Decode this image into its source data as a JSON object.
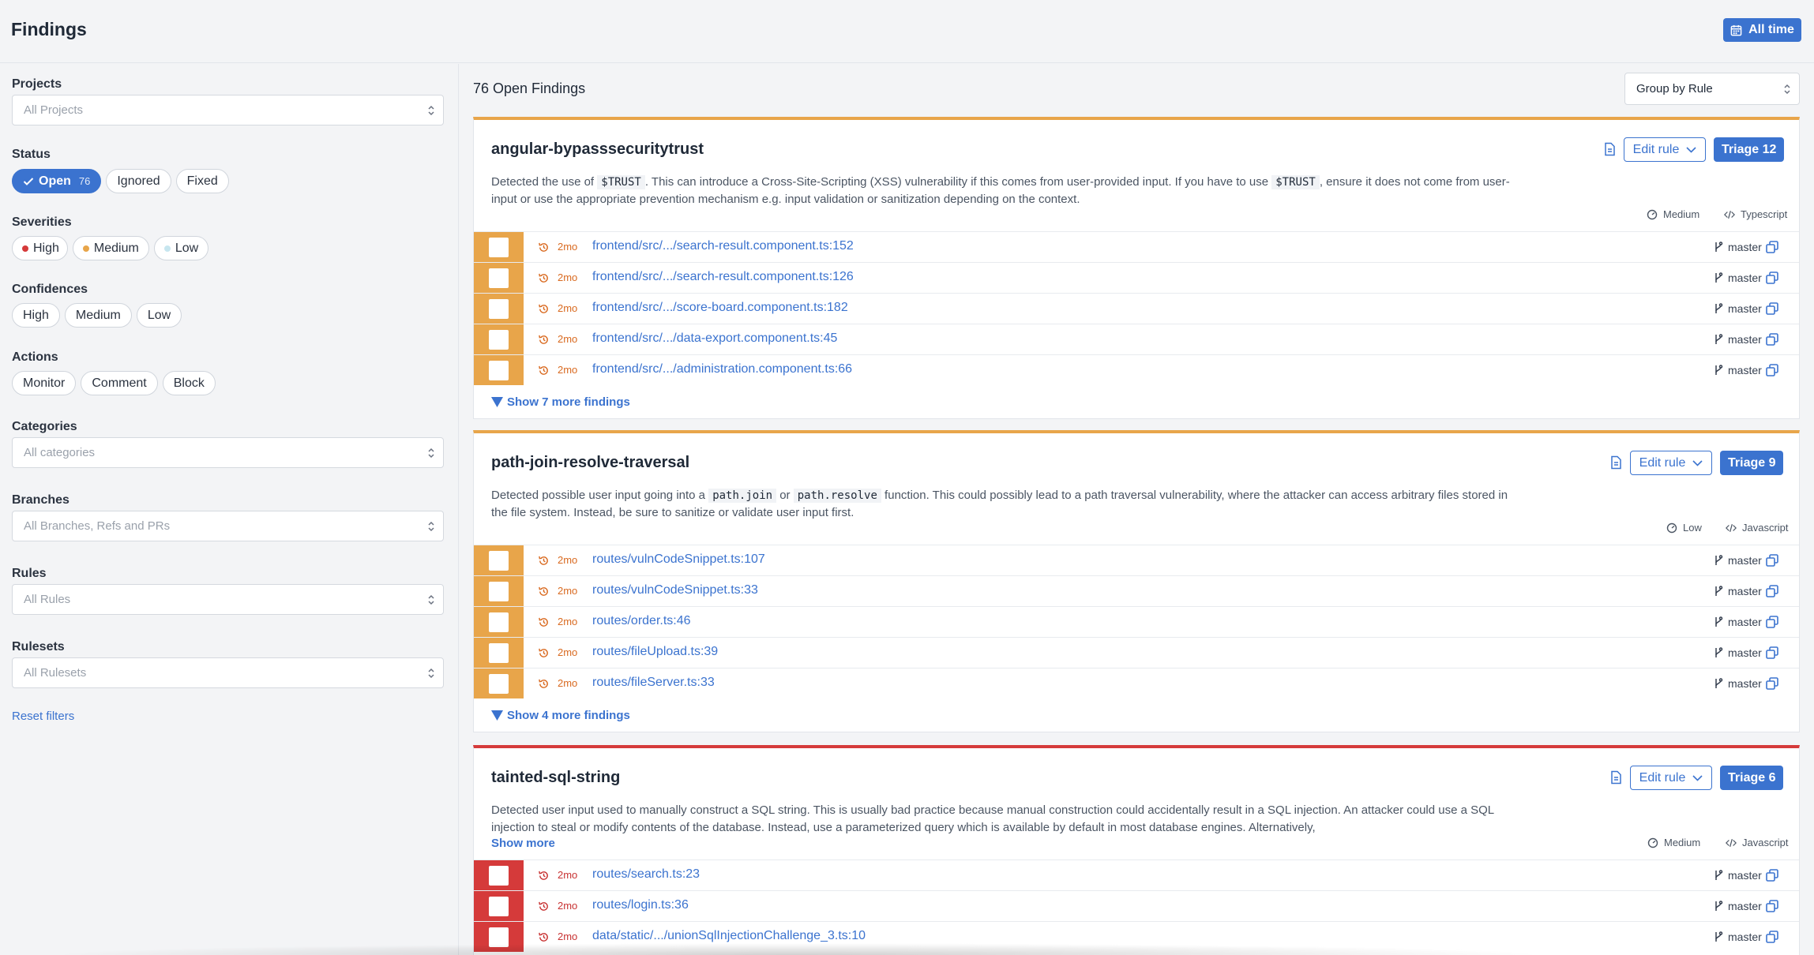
{
  "header": {
    "title": "Findings",
    "date_filter": "All time"
  },
  "sidebar": {
    "projects": {
      "label": "Projects",
      "placeholder": "All Projects"
    },
    "status": {
      "label": "Status",
      "options": [
        {
          "label": "Open",
          "count": "76",
          "active": true
        },
        {
          "label": "Ignored"
        },
        {
          "label": "Fixed"
        }
      ]
    },
    "severities": {
      "label": "Severities",
      "options": [
        {
          "label": "High",
          "color": "#d53a3a"
        },
        {
          "label": "Medium",
          "color": "#e8a54a"
        },
        {
          "label": "Low",
          "color": "#c7e6ef"
        }
      ]
    },
    "confidences": {
      "label": "Confidences",
      "options": [
        "High",
        "Medium",
        "Low"
      ]
    },
    "actions": {
      "label": "Actions",
      "options": [
        "Monitor",
        "Comment",
        "Block"
      ]
    },
    "categories": {
      "label": "Categories",
      "placeholder": "All categories"
    },
    "branches": {
      "label": "Branches",
      "placeholder": "All Branches, Refs and PRs"
    },
    "rules": {
      "label": "Rules",
      "placeholder": "All Rules"
    },
    "rulesets": {
      "label": "Rulesets",
      "placeholder": "All Rulesets"
    },
    "reset": "Reset filters"
  },
  "main": {
    "count_title": "76 Open Findings",
    "group_by": "Group by Rule",
    "edit_rule_label": "Edit rule",
    "groups": [
      {
        "rule": "angular-bypasssecuritytrust",
        "severity": "medium",
        "desc_parts": [
          "Detected the use of ",
          "$TRUST",
          ". This can introduce a Cross-Site-Scripting (XSS) vulnerability if this comes from user-provided input. If you have to use ",
          "$TRUST",
          ", ensure it does not come from user-input or use the appropriate prevention mechanism e.g. input validation or sanitization depending on the context."
        ],
        "triage": "Triage 12",
        "confidence": "Medium",
        "language": "Typescript",
        "findings": [
          {
            "age": "2mo",
            "path": "frontend/src/.../search-result.component.ts:152",
            "branch": "master"
          },
          {
            "age": "2mo",
            "path": "frontend/src/.../search-result.component.ts:126",
            "branch": "master"
          },
          {
            "age": "2mo",
            "path": "frontend/src/.../score-board.component.ts:182",
            "branch": "master"
          },
          {
            "age": "2mo",
            "path": "frontend/src/.../data-export.component.ts:45",
            "branch": "master"
          },
          {
            "age": "2mo",
            "path": "frontend/src/.../administration.component.ts:66",
            "branch": "master"
          }
        ],
        "show_more_findings": "Show 7 more findings"
      },
      {
        "rule": "path-join-resolve-traversal",
        "severity": "medium",
        "desc_parts": [
          "Detected possible user input going into a ",
          "path.join",
          " or ",
          "path.resolve",
          " function. This could possibly lead to a path traversal vulnerability, where the attacker can access arbitrary files stored in the file system. Instead, be sure to sanitize or validate user input first."
        ],
        "triage": "Triage 9",
        "confidence": "Low",
        "language": "Javascript",
        "findings": [
          {
            "age": "2mo",
            "path": "routes/vulnCodeSnippet.ts:107",
            "branch": "master"
          },
          {
            "age": "2mo",
            "path": "routes/vulnCodeSnippet.ts:33",
            "branch": "master"
          },
          {
            "age": "2mo",
            "path": "routes/order.ts:46",
            "branch": "master"
          },
          {
            "age": "2mo",
            "path": "routes/fileUpload.ts:39",
            "branch": "master"
          },
          {
            "age": "2mo",
            "path": "routes/fileServer.ts:33",
            "branch": "master"
          }
        ],
        "show_more_findings": "Show 4 more findings"
      },
      {
        "rule": "tainted-sql-string",
        "severity": "high",
        "description": "Detected user input used to manually construct a SQL string. This is usually bad practice because manual construction could accidentally result in a SQL injection. An attacker could use a SQL injection to steal or modify contents of the database. Instead, use a parameterized query which is available by default in most database engines. Alternatively,",
        "show_more": "Show more",
        "triage": "Triage 6",
        "confidence": "Medium",
        "language": "Javascript",
        "findings": [
          {
            "age": "2mo",
            "path": "routes/search.ts:23",
            "branch": "master"
          },
          {
            "age": "2mo",
            "path": "routes/login.ts:36",
            "branch": "master"
          },
          {
            "age": "2mo",
            "path": "data/static/.../unionSqlInjectionChallenge_3.ts:10",
            "branch": "master"
          }
        ]
      }
    ]
  }
}
